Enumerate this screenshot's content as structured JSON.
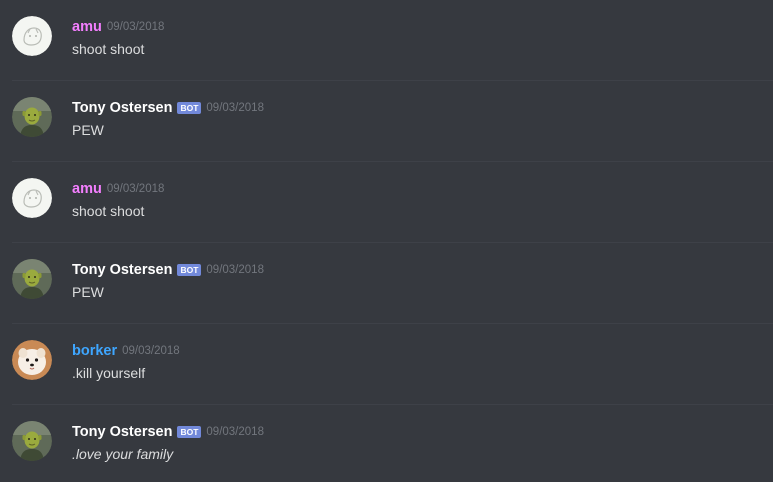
{
  "colors": {
    "background": "#36393f",
    "divider": "#3e4148",
    "message_text": "#dcddde",
    "timestamp": "#72767d",
    "bot_tag_bg": "#7289da",
    "amu_name": "#f47fff",
    "borker_name": "#3ea6ff",
    "tony_name": "#ffffff"
  },
  "messages": [
    {
      "username": "amu",
      "name_color": "#f47fff",
      "is_bot": false,
      "bot_tag": "",
      "timestamp": "09/03/2018",
      "content": "shoot shoot",
      "italic": false,
      "avatar_icon": "amu-avatar-icon"
    },
    {
      "username": "Tony Ostersen",
      "name_color": "#ffffff",
      "is_bot": true,
      "bot_tag": "BOT",
      "timestamp": "09/03/2018",
      "content": "PEW",
      "italic": false,
      "avatar_icon": "shrek-avatar-icon"
    },
    {
      "username": "amu",
      "name_color": "#f47fff",
      "is_bot": false,
      "bot_tag": "",
      "timestamp": "09/03/2018",
      "content": "shoot shoot",
      "italic": false,
      "avatar_icon": "amu-avatar-icon"
    },
    {
      "username": "Tony Ostersen",
      "name_color": "#ffffff",
      "is_bot": true,
      "bot_tag": "BOT",
      "timestamp": "09/03/2018",
      "content": "PEW",
      "italic": false,
      "avatar_icon": "shrek-avatar-icon"
    },
    {
      "username": "borker",
      "name_color": "#3ea6ff",
      "is_bot": false,
      "bot_tag": "",
      "timestamp": "09/03/2018",
      "content": ".kill yourself",
      "italic": false,
      "avatar_icon": "dog-avatar-icon"
    },
    {
      "username": "Tony Ostersen",
      "name_color": "#ffffff",
      "is_bot": true,
      "bot_tag": "BOT",
      "timestamp": "09/03/2018",
      "content": ".love your family",
      "italic": true,
      "avatar_icon": "shrek-avatar-icon"
    }
  ]
}
